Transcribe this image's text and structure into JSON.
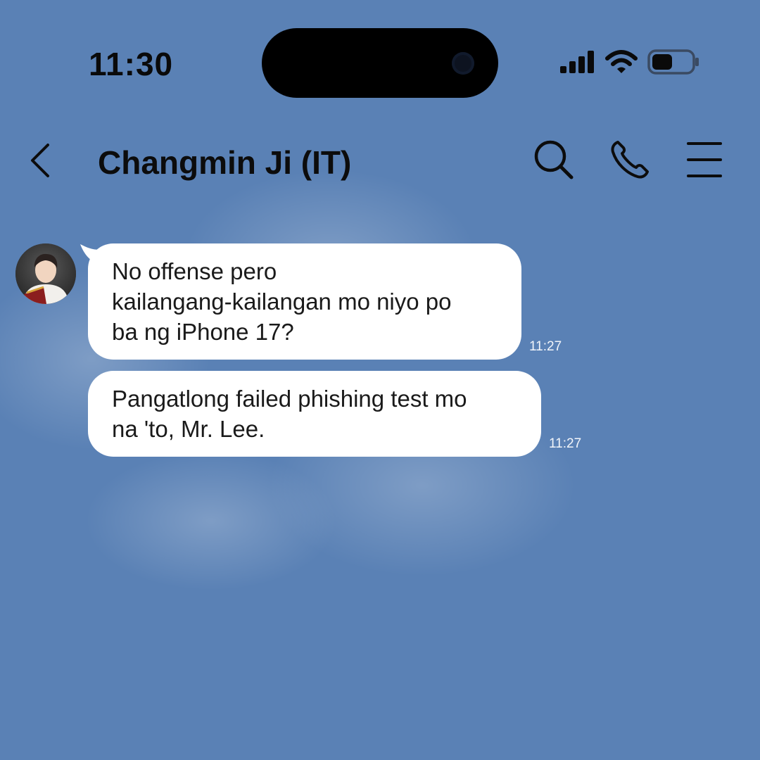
{
  "status_bar": {
    "time": "11:30",
    "icons": [
      "cellular-signal-icon",
      "wifi-icon",
      "battery-icon"
    ]
  },
  "header": {
    "back_icon": "chevron-left-icon",
    "title": "Changmin Ji (IT)",
    "actions": [
      "search-icon",
      "phone-icon",
      "menu-icon"
    ]
  },
  "messages": [
    {
      "text": "No offense pero\nkailangang-kailangan mo niyo po\nba ng iPhone 17?",
      "time": "11:27"
    },
    {
      "text": "Pangatlong failed phishing test mo\nna 'to, Mr. Lee.",
      "time": "11:27"
    }
  ],
  "colors": {
    "background": "#5a81b5",
    "bubble": "#ffffff",
    "text": "#1a1a1a"
  }
}
